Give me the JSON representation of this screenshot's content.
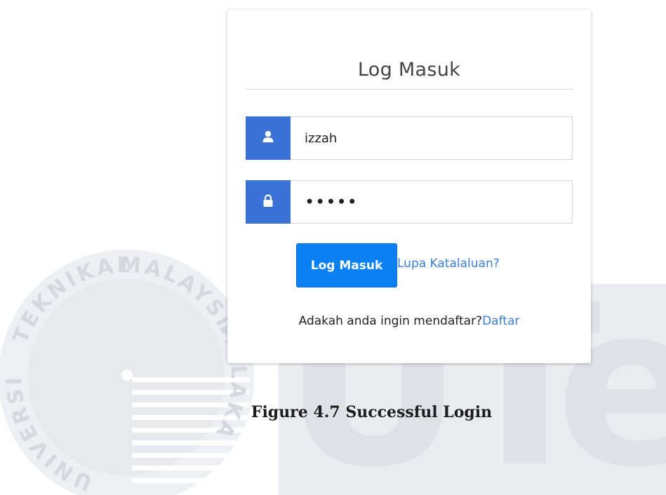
{
  "login_card": {
    "title": "Log Masuk",
    "username": {
      "icon": "user-icon",
      "value": "izzah"
    },
    "password": {
      "icon": "lock-icon",
      "value": "•••••"
    },
    "login_button_label": "Log Masuk",
    "forgot_password_link": "Lupa Katalaluan?",
    "register_prompt": "Adakah anda ingin mendaftar?",
    "register_link": "Daftar"
  },
  "caption": "Figure 4.7 Successful Login",
  "watermark": {
    "seal_text_top": "MALAYSIA",
    "seal_text_right": "MELAKA",
    "seal_text_left": "TEKNIKAL",
    "seal_text_bottom": "UNIVERSITI",
    "letters": "UTeM"
  },
  "colors": {
    "addon_blue": "#3b72d6",
    "button_blue": "#0a80f3",
    "link_blue": "#3a7fd6"
  }
}
